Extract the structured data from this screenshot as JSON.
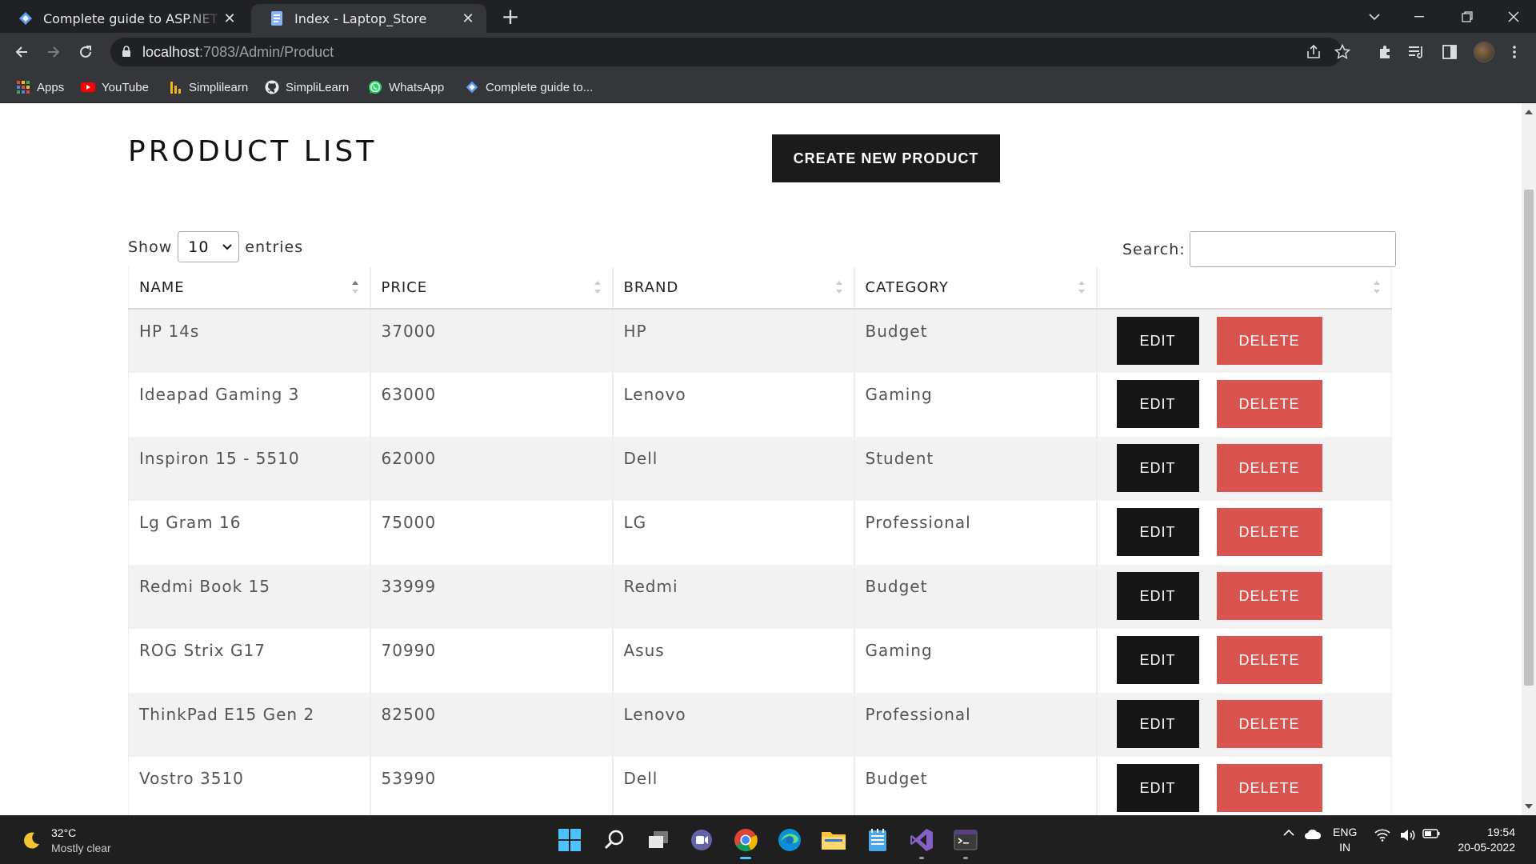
{
  "browser": {
    "tabs": [
      {
        "title": "Complete guide to ASP.NET Core",
        "active": false
      },
      {
        "title": "Index - Laptop_Store",
        "active": true
      }
    ],
    "url_host": "localhost",
    "url_rest": ":7083/Admin/Product",
    "bookmarks": [
      {
        "label": "Apps",
        "icon": "apps-grid-icon"
      },
      {
        "label": "YouTube",
        "icon": "youtube-icon"
      },
      {
        "label": "Simplilearn",
        "icon": "simplilearn-icon"
      },
      {
        "label": "SimpliLearn",
        "icon": "github-icon"
      },
      {
        "label": "WhatsApp",
        "icon": "whatsapp-icon"
      },
      {
        "label": "Complete guide to...",
        "icon": "dotnet-icon"
      }
    ]
  },
  "page": {
    "title": "PRODUCT LIST",
    "create_button": "CREATE NEW PRODUCT",
    "show_label": "Show",
    "entries_value": "10",
    "entries_label": "entries",
    "search_label": "Search:",
    "search_value": "",
    "columns": [
      "NAME",
      "PRICE",
      "BRAND",
      "CATEGORY",
      ""
    ],
    "edit_label": "EDIT",
    "delete_label": "DELETE",
    "rows": [
      {
        "name": "HP 14s",
        "price": "37000",
        "brand": "HP",
        "category": "Budget"
      },
      {
        "name": "Ideapad Gaming 3",
        "price": "63000",
        "brand": "Lenovo",
        "category": "Gaming"
      },
      {
        "name": "Inspiron 15 - 5510",
        "price": "62000",
        "brand": "Dell",
        "category": "Student"
      },
      {
        "name": "Lg Gram 16",
        "price": "75000",
        "brand": "LG",
        "category": "Professional"
      },
      {
        "name": "Redmi Book 15",
        "price": "33999",
        "brand": "Redmi",
        "category": "Budget"
      },
      {
        "name": "ROG Strix G17",
        "price": "70990",
        "brand": "Asus",
        "category": "Gaming"
      },
      {
        "name": "ThinkPad E15 Gen 2",
        "price": "82500",
        "brand": "Lenovo",
        "category": "Professional"
      },
      {
        "name": "Vostro 3510",
        "price": "53990",
        "brand": "Dell",
        "category": "Budget"
      }
    ]
  },
  "taskbar": {
    "temperature": "32°C",
    "weather": "Mostly clear",
    "lang_line1": "ENG",
    "lang_line2": "IN",
    "time": "19:54",
    "date": "20-05-2022"
  },
  "colors": {
    "primary_button": "#1b1b1b",
    "delete_button": "#d9534f",
    "chrome_dark": "#202124",
    "chrome_toolbar": "#35363a"
  }
}
